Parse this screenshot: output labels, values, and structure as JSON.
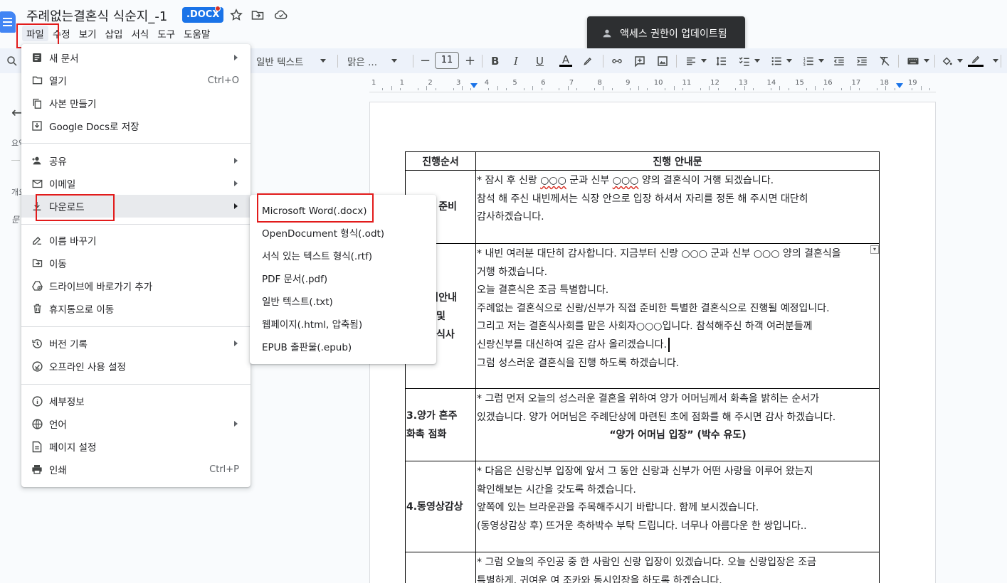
{
  "header": {
    "title": "주례없는결혼식 식순지_-1",
    "badge": ".DOCX"
  },
  "menubar": [
    "파일",
    "수정",
    "보기",
    "삽입",
    "서식",
    "도구",
    "도움말"
  ],
  "toast": {
    "text": "액세스 권한이 업데이트됨"
  },
  "toolbar": {
    "style": "일반 텍스트",
    "font": "맑은 ...",
    "font_size": "11"
  },
  "ruler": {
    "numbers": [
      "1",
      "1",
      "2",
      "3",
      "4",
      "5",
      "6",
      "7",
      "8",
      "9",
      "10",
      "11",
      "12",
      "13",
      "14",
      "15",
      "16",
      "17",
      "18",
      "19"
    ]
  },
  "outline": {
    "items": [
      "요약",
      "개요",
      "문"
    ]
  },
  "file_menu": {
    "items": [
      {
        "label": "새 문서",
        "icon": "new-doc-icon",
        "submenu": true
      },
      {
        "label": "열기",
        "icon": "folder-icon",
        "shortcut": "Ctrl+O"
      },
      {
        "label": "사본 만들기",
        "icon": "copy-icon"
      },
      {
        "label": "Google Docs로 저장",
        "icon": "save-to-docs-icon"
      },
      {
        "label": "공유",
        "icon": "person-add-icon",
        "submenu": true
      },
      {
        "label": "이메일",
        "icon": "mail-icon",
        "submenu": true
      },
      {
        "label": "다운로드",
        "icon": "download-icon",
        "submenu": true,
        "highlighted": true
      },
      {
        "label": "이름 바꾸기",
        "icon": "rename-icon"
      },
      {
        "label": "이동",
        "icon": "move-folder-icon"
      },
      {
        "label": "드라이브에 바로가기 추가",
        "icon": "drive-shortcut-icon"
      },
      {
        "label": "휴지통으로 이동",
        "icon": "trash-icon"
      },
      {
        "label": "버전 기록",
        "icon": "history-icon",
        "submenu": true
      },
      {
        "label": "오프라인 사용 설정",
        "icon": "offline-icon"
      },
      {
        "label": "세부정보",
        "icon": "info-icon"
      },
      {
        "label": "언어",
        "icon": "globe-icon",
        "submenu": true
      },
      {
        "label": "페이지 설정",
        "icon": "page-setup-icon"
      },
      {
        "label": "인쇄",
        "icon": "print-icon",
        "shortcut": "Ctrl+P"
      }
    ]
  },
  "download_menu": {
    "items": [
      "Microsoft Word(.docx)",
      "OpenDocument 형식(.odt)",
      "서식 있는 텍스트 형식(.rtf)",
      "PDF 문서(.pdf)",
      "일반 텍스트(.txt)",
      "웹페이지(.html, 압축됨)",
      "EPUB 출판물(.epub)"
    ]
  },
  "document": {
    "headers": [
      "진행순서",
      "진행 안내문"
    ],
    "rows": [
      {
        "step": "준비",
        "lines": [
          "* 잠시 후 신랑 ",
          "○○○",
          " 군과 신부 ",
          "○○○",
          " 양의 결혼식이 거행 되겠습니다.",
          "참석 해 주신 내빈께서는 식장 안으로 입장 하셔서 자리를 정돈 해 주시면 대단히",
          "감사하겠습니다."
        ]
      },
      {
        "step_lines": [
          "회안내",
          "및",
          "식사"
        ],
        "lines": [
          "* 내빈 여러분 대단히 감사합니다. 지금부터 신랑 ○○○ 군과 신부 ○○○ 양의 결혼식을",
          "거행 하겠습니다.",
          "오늘 결혼식은 조금 특별합니다.",
          "주례없는 결혼식으로 신랑/신부가 직접 준비한 특별한 결혼식으로 진행될 예정입니다.",
          "그리고 저는 결혼식사회를 맡은 사회자○○○입니다. 참석해주신 하객 여러분들께",
          "신랑신부를 대신하여 깊은 감사 올리겠습니다.",
          "그럼 성스러운 결혼식을 진행 하도록 하겠습니다."
        ]
      },
      {
        "step_lines": [
          "3.양가 혼주",
          "화촉 점화"
        ],
        "lines": [
          "* 그럼 먼저 오늘의 성스러운 결혼을 위하여 양가 어머님께서 화촉을 밝히는 순서가",
          "있겠습니다. 양가 어머님은 주례단상에 마련된 초에 점화를 해 주시면 감사 하겠습니다.",
          "“양가 어머님 입장” (박수 유도)"
        ]
      },
      {
        "step": "4.동영상감상",
        "lines": [
          "* 다음은 신랑신부 입장에 앞서 그 동안 신랑과 신부가 어떤 사랑을 이루어 왔는지",
          "확인해보는 시간을 갖도록 하겠습니다.",
          "앞쪽에 있는 브라운관을 주목해주시기 바랍니다. 함께 보시겠습니다.",
          "(동영상감상 후) 뜨거운 축하박수 부탁 드립니다. 너무나 아름다운 한 쌍입니다.."
        ]
      },
      {
        "step": "",
        "lines": [
          "* 그럼 오늘의 주인공 중 한 사람인 신랑 입장이 있겠습니다. 오늘 신랑입장은 조금",
          "특별하게, 귀여운 여 조카와 동시입장을 하도록 하겠습니다."
        ]
      }
    ]
  },
  "colors": {
    "accent": "#1a73e8",
    "highlight_box": "#e21b1b",
    "toolbar_bg": "#edf2fa"
  }
}
